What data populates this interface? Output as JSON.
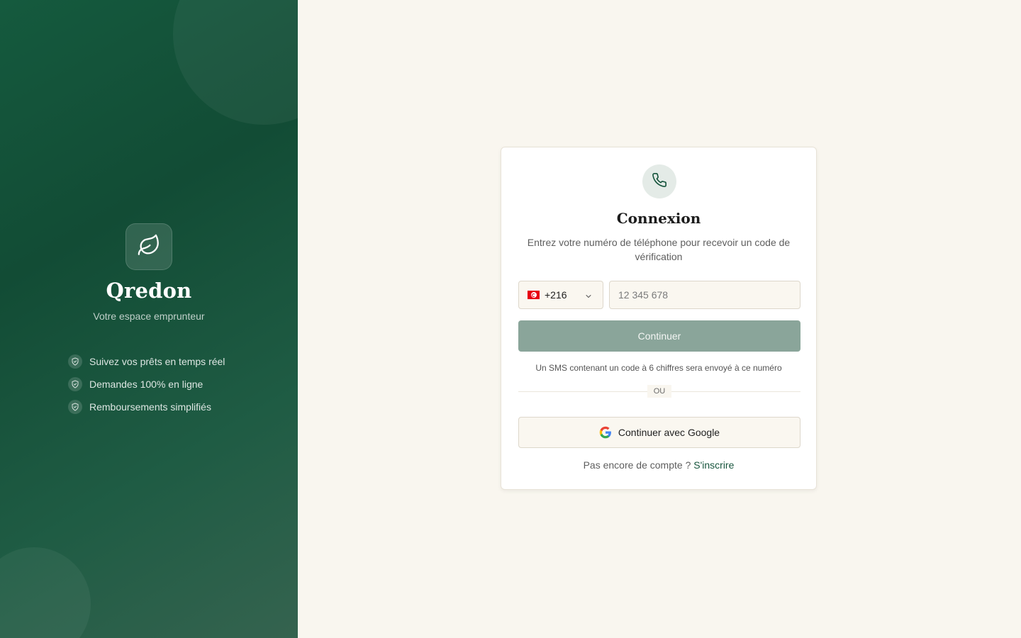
{
  "brand": {
    "name": "Qredon",
    "tagline": "Votre espace emprunteur",
    "logo_icon": "leaf-icon",
    "features": [
      {
        "icon": "shield-check-icon",
        "label": "Suivez vos prêts en temps réel"
      },
      {
        "icon": "shield-check-icon",
        "label": "Demandes 100% en ligne"
      },
      {
        "icon": "shield-check-icon",
        "label": "Remboursements simplifiés"
      }
    ]
  },
  "login": {
    "header_icon": "phone-icon",
    "title": "Connexion",
    "subtitle": "Entrez votre numéro de téléphone pour recevoir un code de vérification",
    "country": {
      "flag": "tunisia-flag-icon",
      "dial_code": "+216"
    },
    "phone_input": {
      "placeholder": "12 345 678",
      "value": ""
    },
    "continue_label": "Continuer",
    "sms_hint": "Un SMS contenant un code à 6 chiffres sera envoyé à ce numéro",
    "divider_label": "OU",
    "google_label": "Continuer avec Google",
    "signup_prompt": "Pas encore de compte ?",
    "signup_link": "S'inscrire"
  },
  "colors": {
    "brand_green": "#124c35",
    "accent_link": "#17553d",
    "button_disabled": "#8aa59a",
    "page_background": "#f9f6ef"
  }
}
